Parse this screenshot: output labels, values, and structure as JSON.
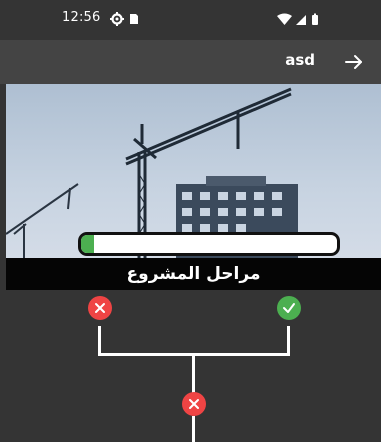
{
  "status_bar": {
    "time": "12:56"
  },
  "app_bar": {
    "title": "asd"
  },
  "hero": {
    "progress_fraction": 0.05
  },
  "section": {
    "title": "مراحل المشروع"
  },
  "stages": [
    {
      "status": "rejected",
      "icon": "close-icon"
    },
    {
      "status": "approved",
      "icon": "check-icon"
    },
    {
      "status": "rejected",
      "icon": "close-icon"
    }
  ],
  "colors": {
    "background": "#343434",
    "app_bar": "#444444",
    "rejected": "#ef4444",
    "approved": "#4caf50",
    "title_bar": "#050505"
  }
}
